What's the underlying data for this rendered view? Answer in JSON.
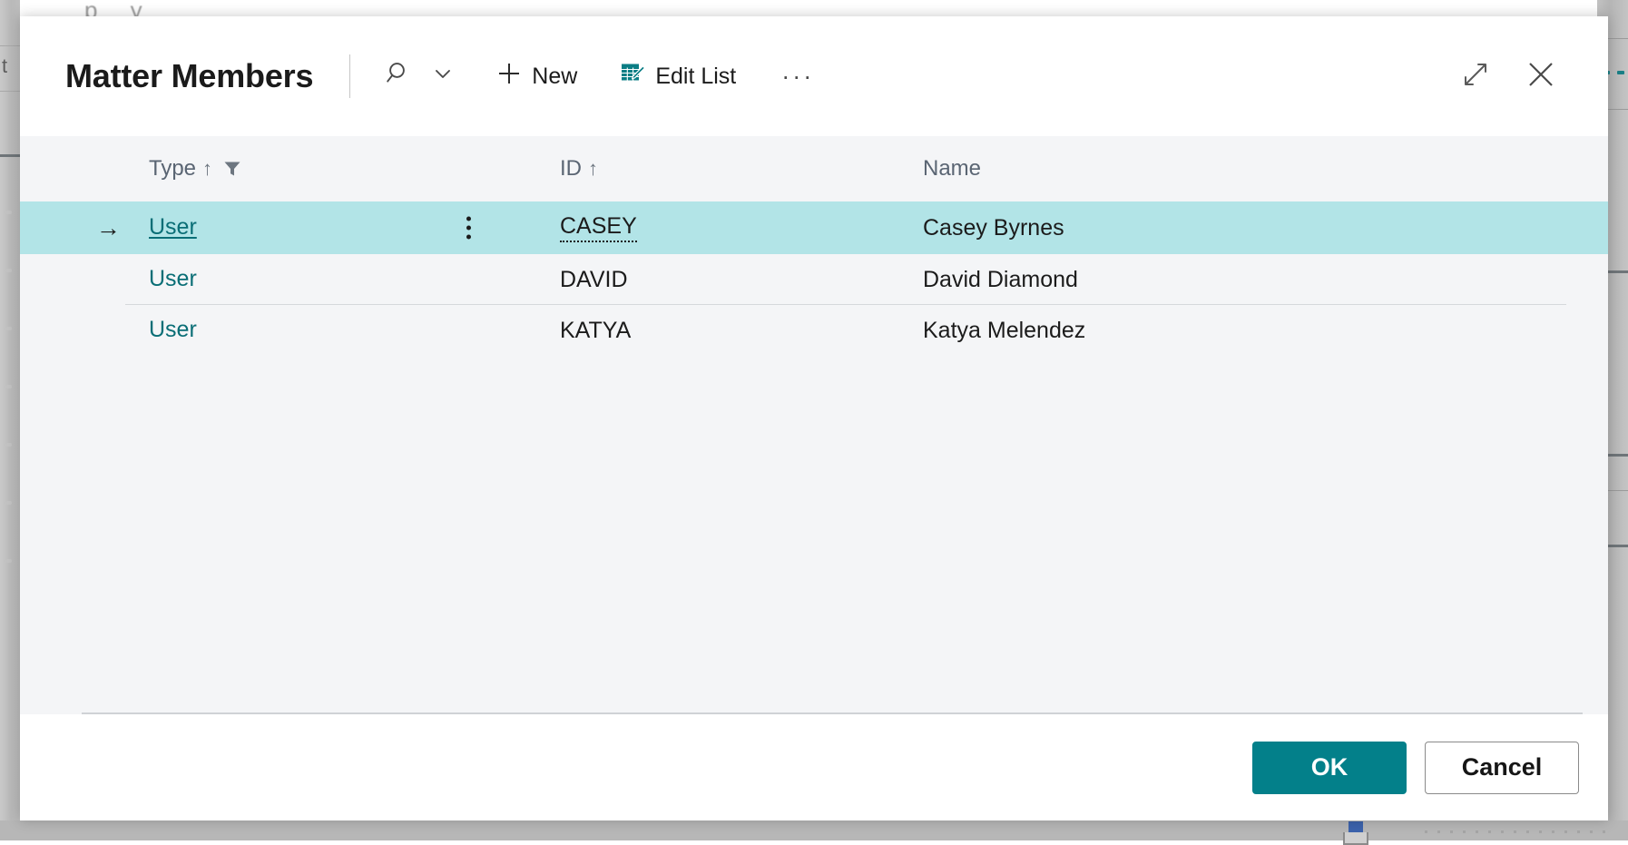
{
  "dialog": {
    "title": "Matter Members",
    "toolbar": {
      "search_label": "",
      "search_icon": "search-icon",
      "search_chevron_icon": "chevron-down-icon",
      "new_label": "New",
      "new_icon": "plus-icon",
      "edit_list_label": "Edit List",
      "edit_list_icon": "edit-list-icon",
      "overflow_label": "···",
      "overflow_icon": "ellipsis-icon"
    },
    "window_controls": {
      "expand_icon": "expand-diagonal-icon",
      "close_icon": "close-icon"
    },
    "footer": {
      "ok_label": "OK",
      "cancel_label": "Cancel"
    }
  },
  "grid": {
    "columns": [
      {
        "label": "Type",
        "sort_indicator": "↑",
        "has_filter": true
      },
      {
        "label": "ID",
        "sort_indicator": "↑",
        "has_filter": false
      },
      {
        "label": "Name",
        "sort_indicator": "",
        "has_filter": false
      }
    ],
    "rows": [
      {
        "indicator": "→",
        "type": "User",
        "id": "CASEY",
        "name": "Casey Byrnes",
        "selected": true
      },
      {
        "indicator": "",
        "type": "User",
        "id": "DAVID",
        "name": "David Diamond",
        "selected": false
      },
      {
        "indicator": "",
        "type": "User",
        "id": "KATYA",
        "name": "Katya Melendez",
        "selected": false
      }
    ]
  },
  "colors": {
    "accent_teal": "#03808A",
    "link_teal": "#0A6E76",
    "selected_row": "#B2E4E7",
    "content_bg": "#F4F5F7",
    "header_text": "#5A6573"
  }
}
